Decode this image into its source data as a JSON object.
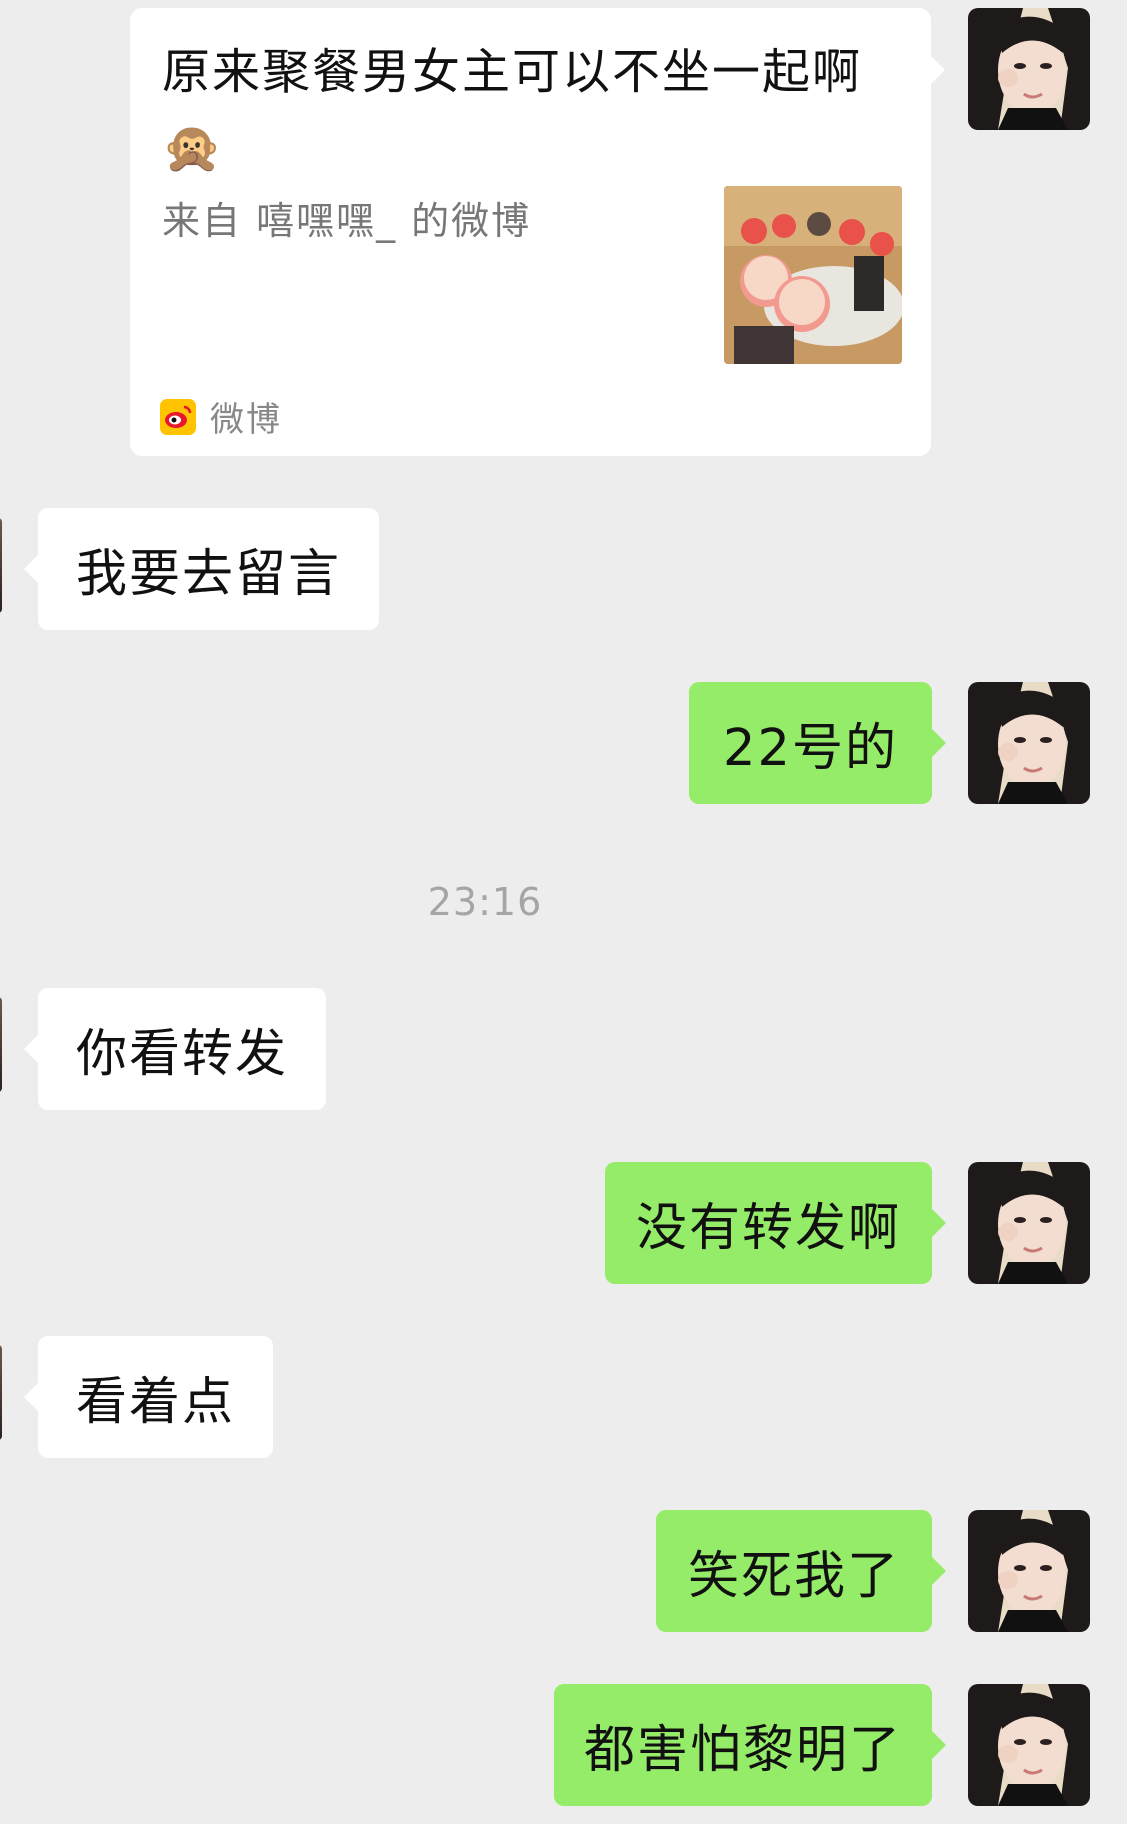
{
  "shared_card": {
    "title": "原来聚餐男女主可以不坐一起啊",
    "emoji": "🙊",
    "source": "来自 嘻嘿嘿_ 的微博",
    "app_label": "微博",
    "app_icon": "weibo-icon"
  },
  "timestamp": "23:16",
  "messages": [
    {
      "side": "left",
      "text": "我要去留言"
    },
    {
      "side": "right",
      "text": "22号的"
    },
    {
      "side": "left",
      "text": "你看转发"
    },
    {
      "side": "right",
      "text": "没有转发啊"
    },
    {
      "side": "left",
      "text": "看着点"
    },
    {
      "side": "right",
      "text": "笑死我了"
    },
    {
      "side": "right",
      "text": "都害怕黎明了"
    }
  ],
  "colors": {
    "background": "#ededed",
    "outgoing_bubble": "#95ec69",
    "incoming_bubble": "#ffffff",
    "weibo_brand": "#e6162d"
  }
}
